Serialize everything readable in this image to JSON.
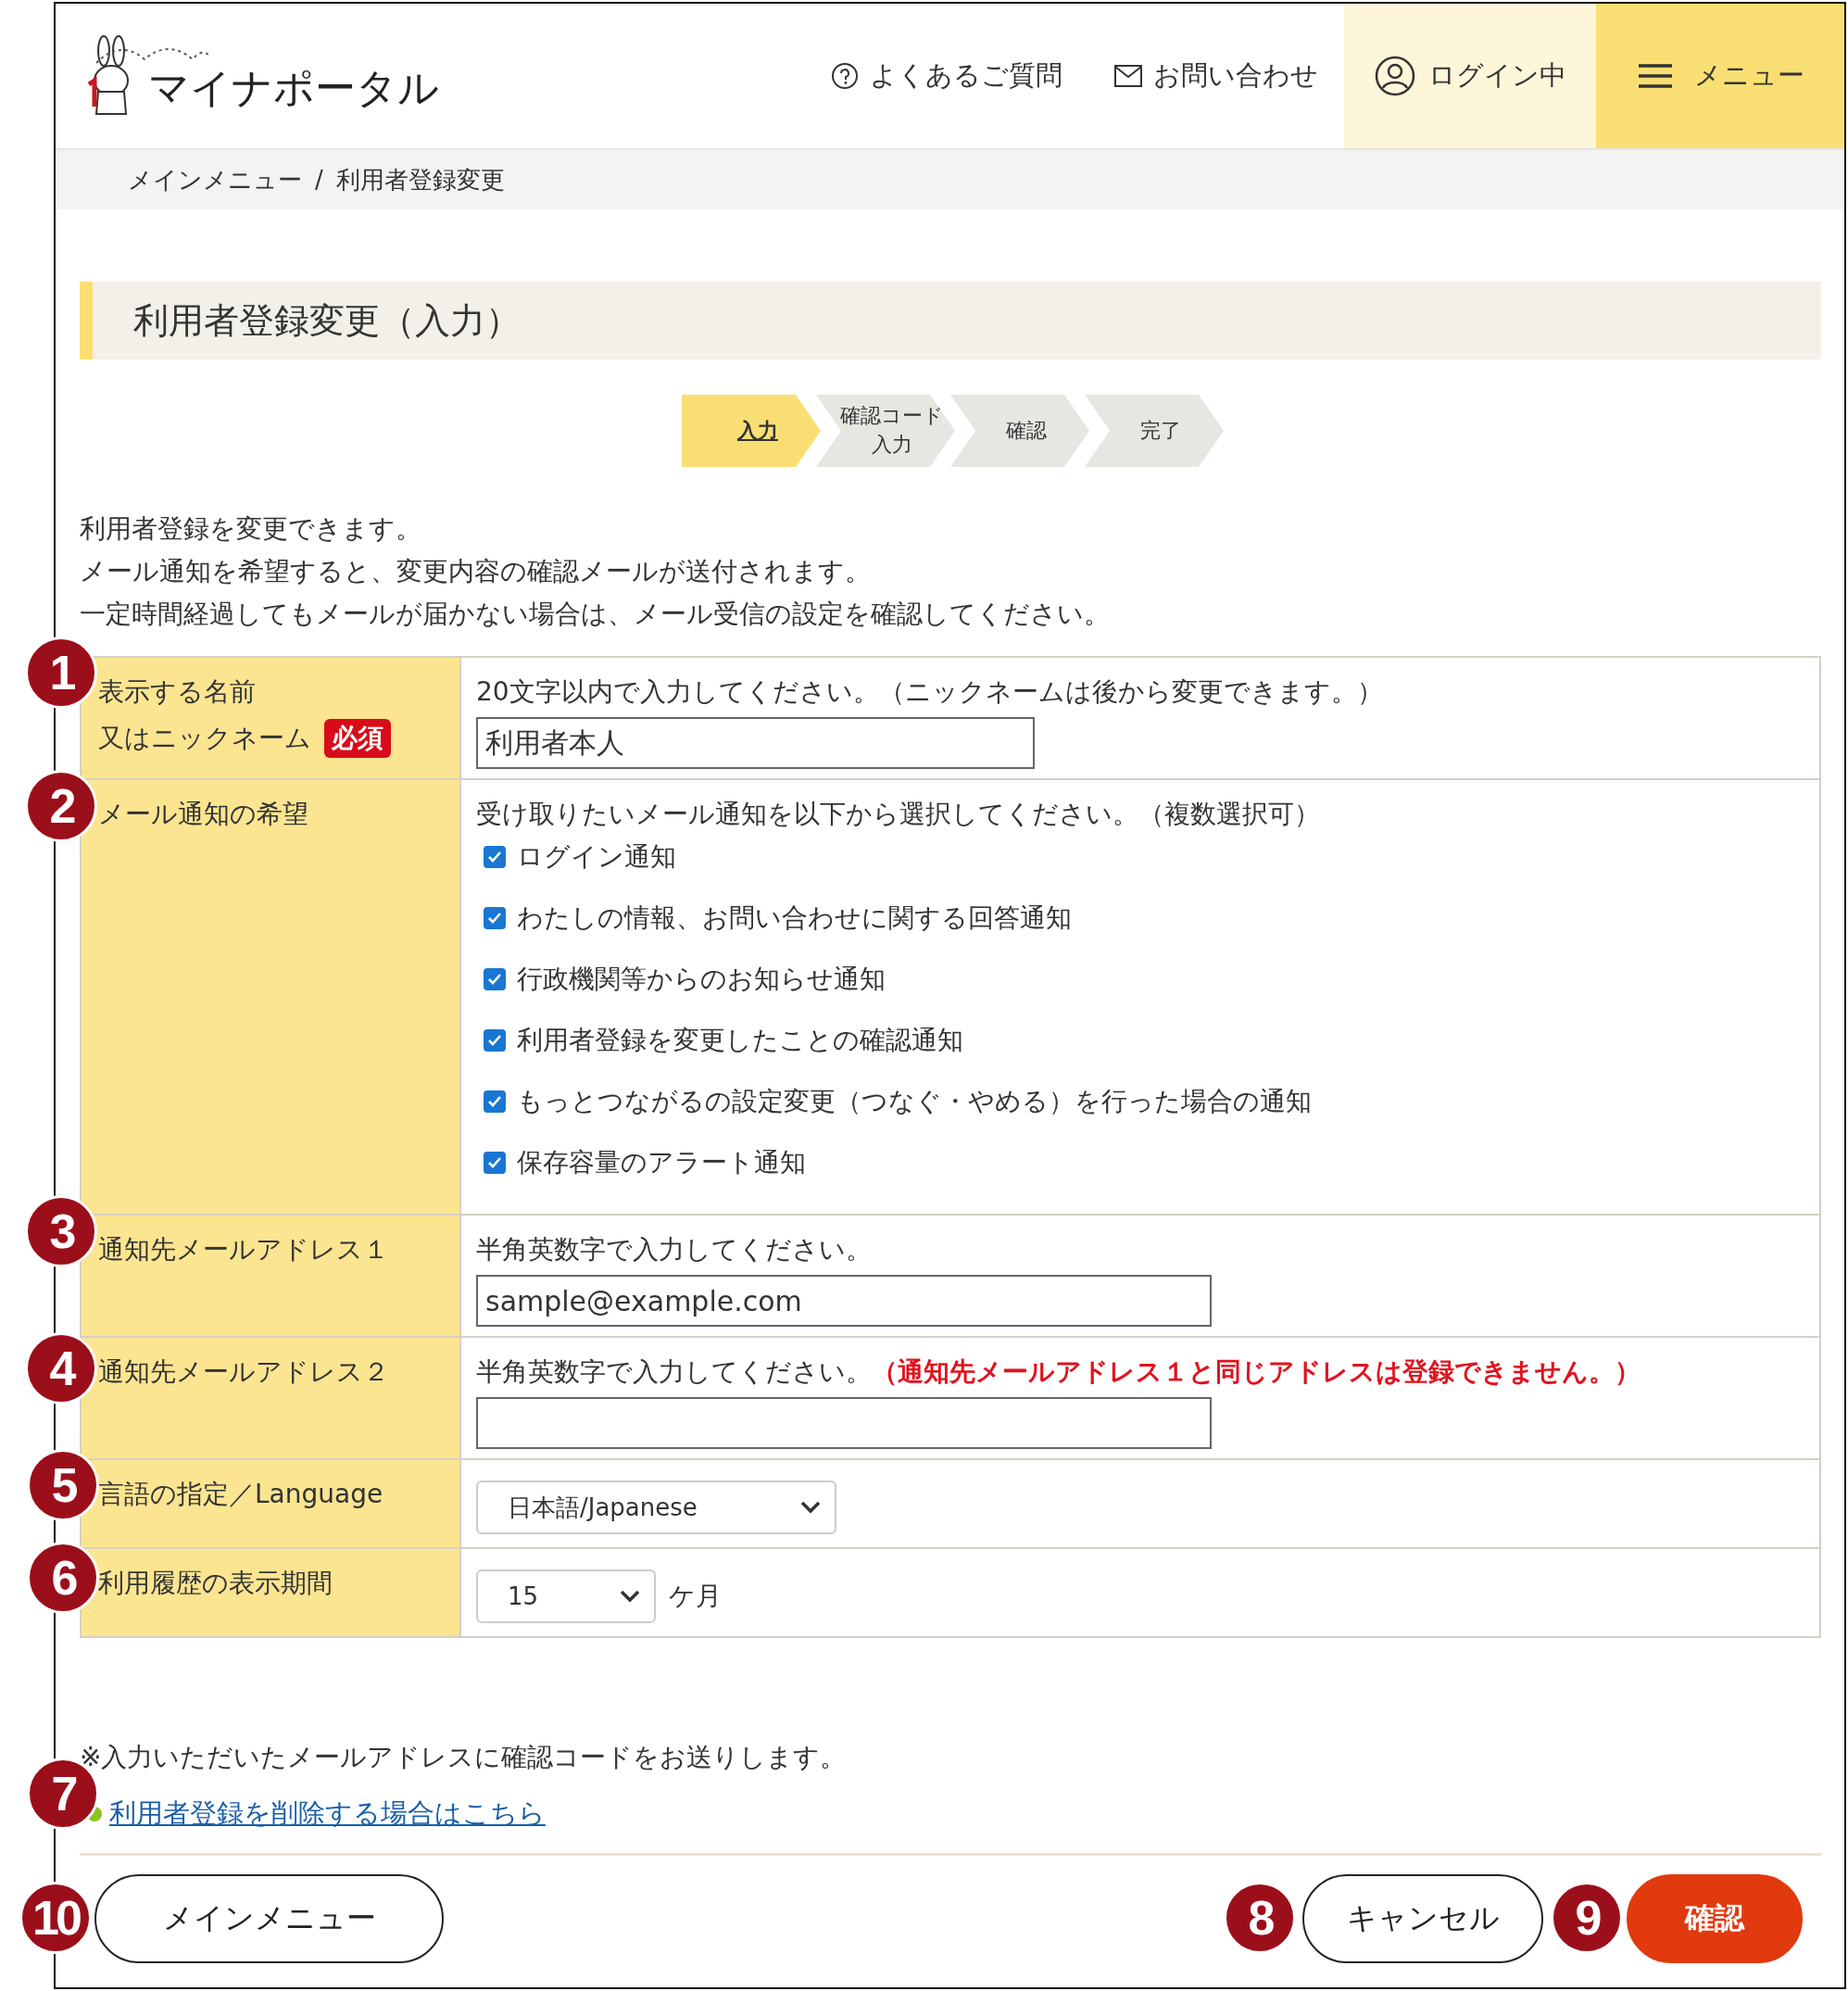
{
  "header": {
    "logo_text": "マイナポータル",
    "nav": [
      {
        "kind": "help",
        "label": "よくあるご質問"
      },
      {
        "kind": "mail",
        "label": "お問い合わせ"
      }
    ],
    "login": "ログイン中",
    "menu": "メニュー"
  },
  "breadcrumb": [
    "メインメニュー",
    "/",
    "利用者登録変更"
  ],
  "page_title": "利用者登録変更（入力）",
  "steps": [
    {
      "label": "入力",
      "selected": true
    },
    {
      "label": "確認コード入力",
      "selected": false
    },
    {
      "label": "確認",
      "selected": false
    },
    {
      "label": "完了",
      "selected": false
    }
  ],
  "intro": [
    "利用者登録を変更できます。",
    "メール通知を希望すると、変更内容の確認メールが送付されます。",
    "一定時間経過してもメールが届かない場合は、メール受信の設定を確認してください。"
  ],
  "form": [
    {
      "kind": "text",
      "label_lines": [
        "表示する名前",
        "又はニックネーム"
      ],
      "required": "必須",
      "hint": "20文字以内で入力してください。（ニックネームは後から変更できます。）",
      "value": "利用者本人",
      "wide": false
    },
    {
      "kind": "checkboxes",
      "label_lines": [
        "メール通知の希望"
      ],
      "hint": "受け取りたいメール通知を以下から選択してください。（複数選択可）",
      "options": [
        {
          "label": "ログイン通知",
          "checked": true
        },
        {
          "label": "わたしの情報、お問い合わせに関する回答通知",
          "checked": true
        },
        {
          "label": "行政機関等からのお知らせ通知",
          "checked": true
        },
        {
          "label": "利用者登録を変更したことの確認通知",
          "checked": true
        },
        {
          "label": "もっとつながるの設定変更（つなぐ・やめる）を行った場合の通知",
          "checked": true
        },
        {
          "label": "保存容量のアラート通知",
          "checked": true
        }
      ]
    },
    {
      "kind": "text",
      "label_lines": [
        "通知先メールアドレス１"
      ],
      "hint": "半角英数字で入力してください。",
      "value": "sample@example.com",
      "wide": true
    },
    {
      "kind": "text",
      "label_lines": [
        "通知先メールアドレス２"
      ],
      "hint": "半角英数字で入力してください。",
      "warning": "（通知先メールアドレス１と同じアドレスは登録できません。）",
      "wide": true
    },
    {
      "kind": "select",
      "label_lines": [
        "言語の指定／Language"
      ],
      "value": "日本語/Japanese",
      "wide": true
    },
    {
      "kind": "select",
      "label_lines": [
        "利用履歴の表示期間"
      ],
      "value": "15",
      "suffix": "ケ月",
      "wide": false
    }
  ],
  "note": "※入力いただいたメールアドレスに確認コードをお送りします。",
  "delete_link": "利用者登録を削除する場合はこちら",
  "buttons": {
    "back": "メインメニュー",
    "cancel": "キャンセル",
    "confirm": "確認"
  },
  "annotations": [
    "1",
    "2",
    "3",
    "4",
    "5",
    "6",
    "7",
    "10",
    "8",
    "9"
  ]
}
